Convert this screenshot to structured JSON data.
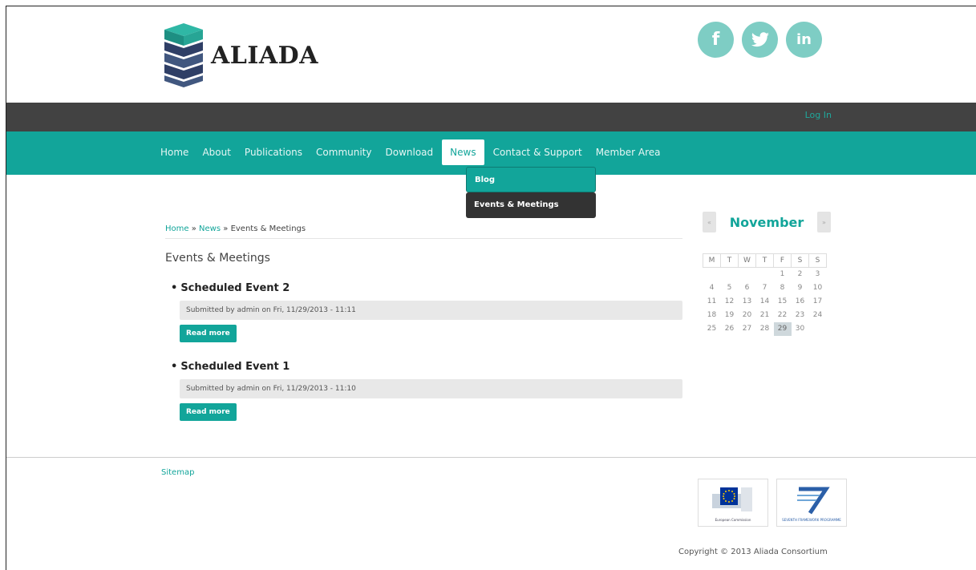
{
  "brand": {
    "name": "ALIADA"
  },
  "social": [
    {
      "icon": "facebook-icon",
      "glyph": "f"
    },
    {
      "icon": "twitter-icon",
      "glyph": "t"
    },
    {
      "icon": "linkedin-icon",
      "glyph": "in"
    }
  ],
  "topbar": {
    "login_label": "Log In"
  },
  "nav": {
    "items": [
      "Home",
      "About",
      "Publications",
      "Community",
      "Download",
      "News",
      "Contact & Support",
      "Member Area"
    ],
    "active": "News"
  },
  "dropdown": {
    "items": [
      "Blog",
      "Events & Meetings"
    ]
  },
  "breadcrumb": {
    "home": "Home",
    "sep": "»",
    "news": "News",
    "current": "Events & Meetings"
  },
  "main": {
    "title": "Events & Meetings",
    "events": [
      {
        "title": "Scheduled Event 2",
        "submitted": "Submitted by admin on Fri, 11/29/2013 - 11:11",
        "read_more": "Read more"
      },
      {
        "title": "Scheduled Event 1",
        "submitted": "Submitted by admin on Fri, 11/29/2013 - 11:10",
        "read_more": "Read more"
      }
    ]
  },
  "calendar": {
    "month": "November",
    "prev": "«",
    "next": "»",
    "weekdays": [
      "M",
      "T",
      "W",
      "T",
      "F",
      "S",
      "S"
    ],
    "weeks": [
      [
        "",
        "",
        "",
        "",
        "1",
        "2",
        "3"
      ],
      [
        "4",
        "5",
        "6",
        "7",
        "8",
        "9",
        "10"
      ],
      [
        "11",
        "12",
        "13",
        "14",
        "15",
        "16",
        "17"
      ],
      [
        "18",
        "19",
        "20",
        "21",
        "22",
        "23",
        "24"
      ],
      [
        "25",
        "26",
        "27",
        "28",
        "29",
        "30",
        ""
      ]
    ],
    "today": "29"
  },
  "footer": {
    "sitemap": "Sitemap",
    "badges": [
      {
        "icon": "european-commission-logo",
        "caption": "European Commission"
      },
      {
        "icon": "seventh-framework-programme-logo",
        "caption": "SEVENTH FRAMEWORK PROGRAMME"
      }
    ],
    "copyright": "Copyright © 2013 Aliada Consortium"
  },
  "colors": {
    "accent": "#12a59a",
    "topbar": "#424242",
    "social": "#7ecdc4"
  }
}
